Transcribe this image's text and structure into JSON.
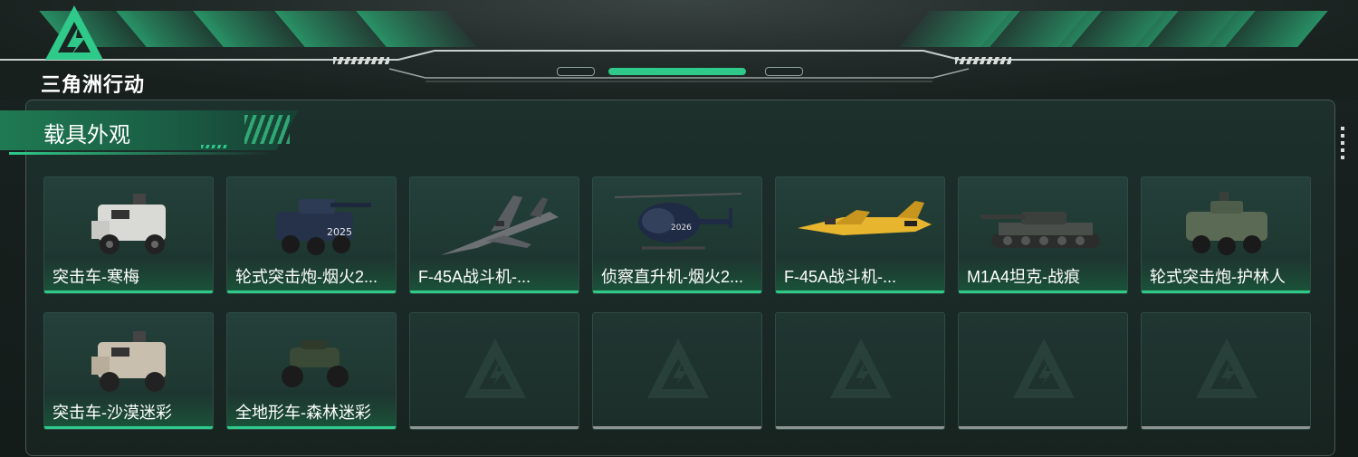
{
  "header": {
    "game_title": "三角洲行动"
  },
  "section": {
    "title": "载具外观"
  },
  "colors": {
    "accent": "#2fc98a",
    "panel": "#1a2926",
    "empty_bar": "#8d9492"
  },
  "grid": {
    "row1": [
      {
        "name": "突击车-寒梅",
        "icon": "armored-car-white-icon"
      },
      {
        "name": "轮式突击炮-烟火2...",
        "icon": "wheeled-assault-gun-blue-icon"
      },
      {
        "name": "F-45A战斗机-...",
        "icon": "fighter-jet-camo-icon"
      },
      {
        "name": "侦察直升机-烟火2...",
        "icon": "scout-helicopter-icon"
      },
      {
        "name": "F-45A战斗机-...",
        "icon": "fighter-jet-yellow-icon"
      },
      {
        "name": "M1A4坦克-战痕",
        "icon": "tank-icon"
      },
      {
        "name": "轮式突击炮-护林人",
        "icon": "wheeled-assault-gun-green-icon"
      }
    ],
    "row2": [
      {
        "name": "突击车-沙漠迷彩",
        "icon": "armored-car-desert-icon"
      },
      {
        "name": "全地形车-森林迷彩",
        "icon": "atv-forest-icon"
      },
      {
        "name": "",
        "icon": "empty-slot-logo-icon"
      },
      {
        "name": "",
        "icon": "empty-slot-logo-icon"
      },
      {
        "name": "",
        "icon": "empty-slot-logo-icon"
      },
      {
        "name": "",
        "icon": "empty-slot-logo-icon"
      },
      {
        "name": "",
        "icon": "empty-slot-logo-icon"
      }
    ]
  }
}
